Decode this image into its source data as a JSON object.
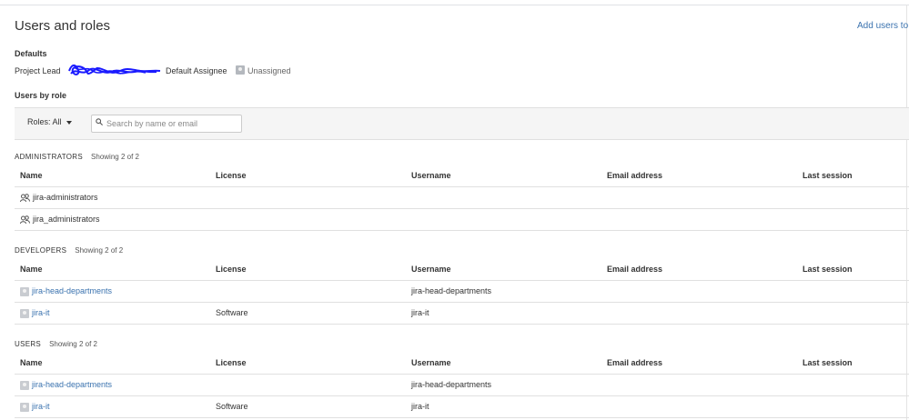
{
  "page": {
    "title": "Users and roles",
    "add_link": "Add users to a"
  },
  "defaults": {
    "heading": "Defaults",
    "project_lead_label": "Project Lead",
    "default_assignee_label": "Default Assignee",
    "default_assignee_value": "Unassigned"
  },
  "users_by_role": {
    "heading": "Users by role"
  },
  "filter": {
    "roles_label": "Roles: All",
    "search_placeholder": "Search by name or email"
  },
  "columns": [
    "Name",
    "License",
    "Username",
    "Email address",
    "Last session"
  ],
  "sections": [
    {
      "name": "ADMINISTRATORS",
      "count": "Showing 2 of 2",
      "rows": [
        {
          "name": "jira-administrators",
          "license": "",
          "username": "",
          "email": "",
          "last": "",
          "type": "group"
        },
        {
          "name": "jira_administrators",
          "license": "",
          "username": "",
          "email": "",
          "last": "",
          "type": "group"
        }
      ]
    },
    {
      "name": "DEVELOPERS",
      "count": "Showing 2 of 2",
      "rows": [
        {
          "name": "jira-head-departments",
          "license": "",
          "username": "jira-head-departments",
          "email": "",
          "last": "",
          "type": "user"
        },
        {
          "name": "jira-it",
          "license": "Software",
          "username": "jira-it",
          "email": "",
          "last": "",
          "type": "user"
        }
      ]
    },
    {
      "name": "USERS",
      "count": "Showing 2 of 2",
      "rows": [
        {
          "name": "jira-head-departments",
          "license": "",
          "username": "jira-head-departments",
          "email": "",
          "last": "",
          "type": "user"
        },
        {
          "name": "jira-it",
          "license": "Software",
          "username": "jira-it",
          "email": "",
          "last": "",
          "type": "user"
        }
      ]
    }
  ],
  "icons": {
    "search": "search-icon",
    "dropdown": "chevron-down-icon",
    "group": "group-icon",
    "user": "user-avatar-icon"
  },
  "colors": {
    "link": "#3b73af",
    "redaction": "#1a1aff"
  }
}
